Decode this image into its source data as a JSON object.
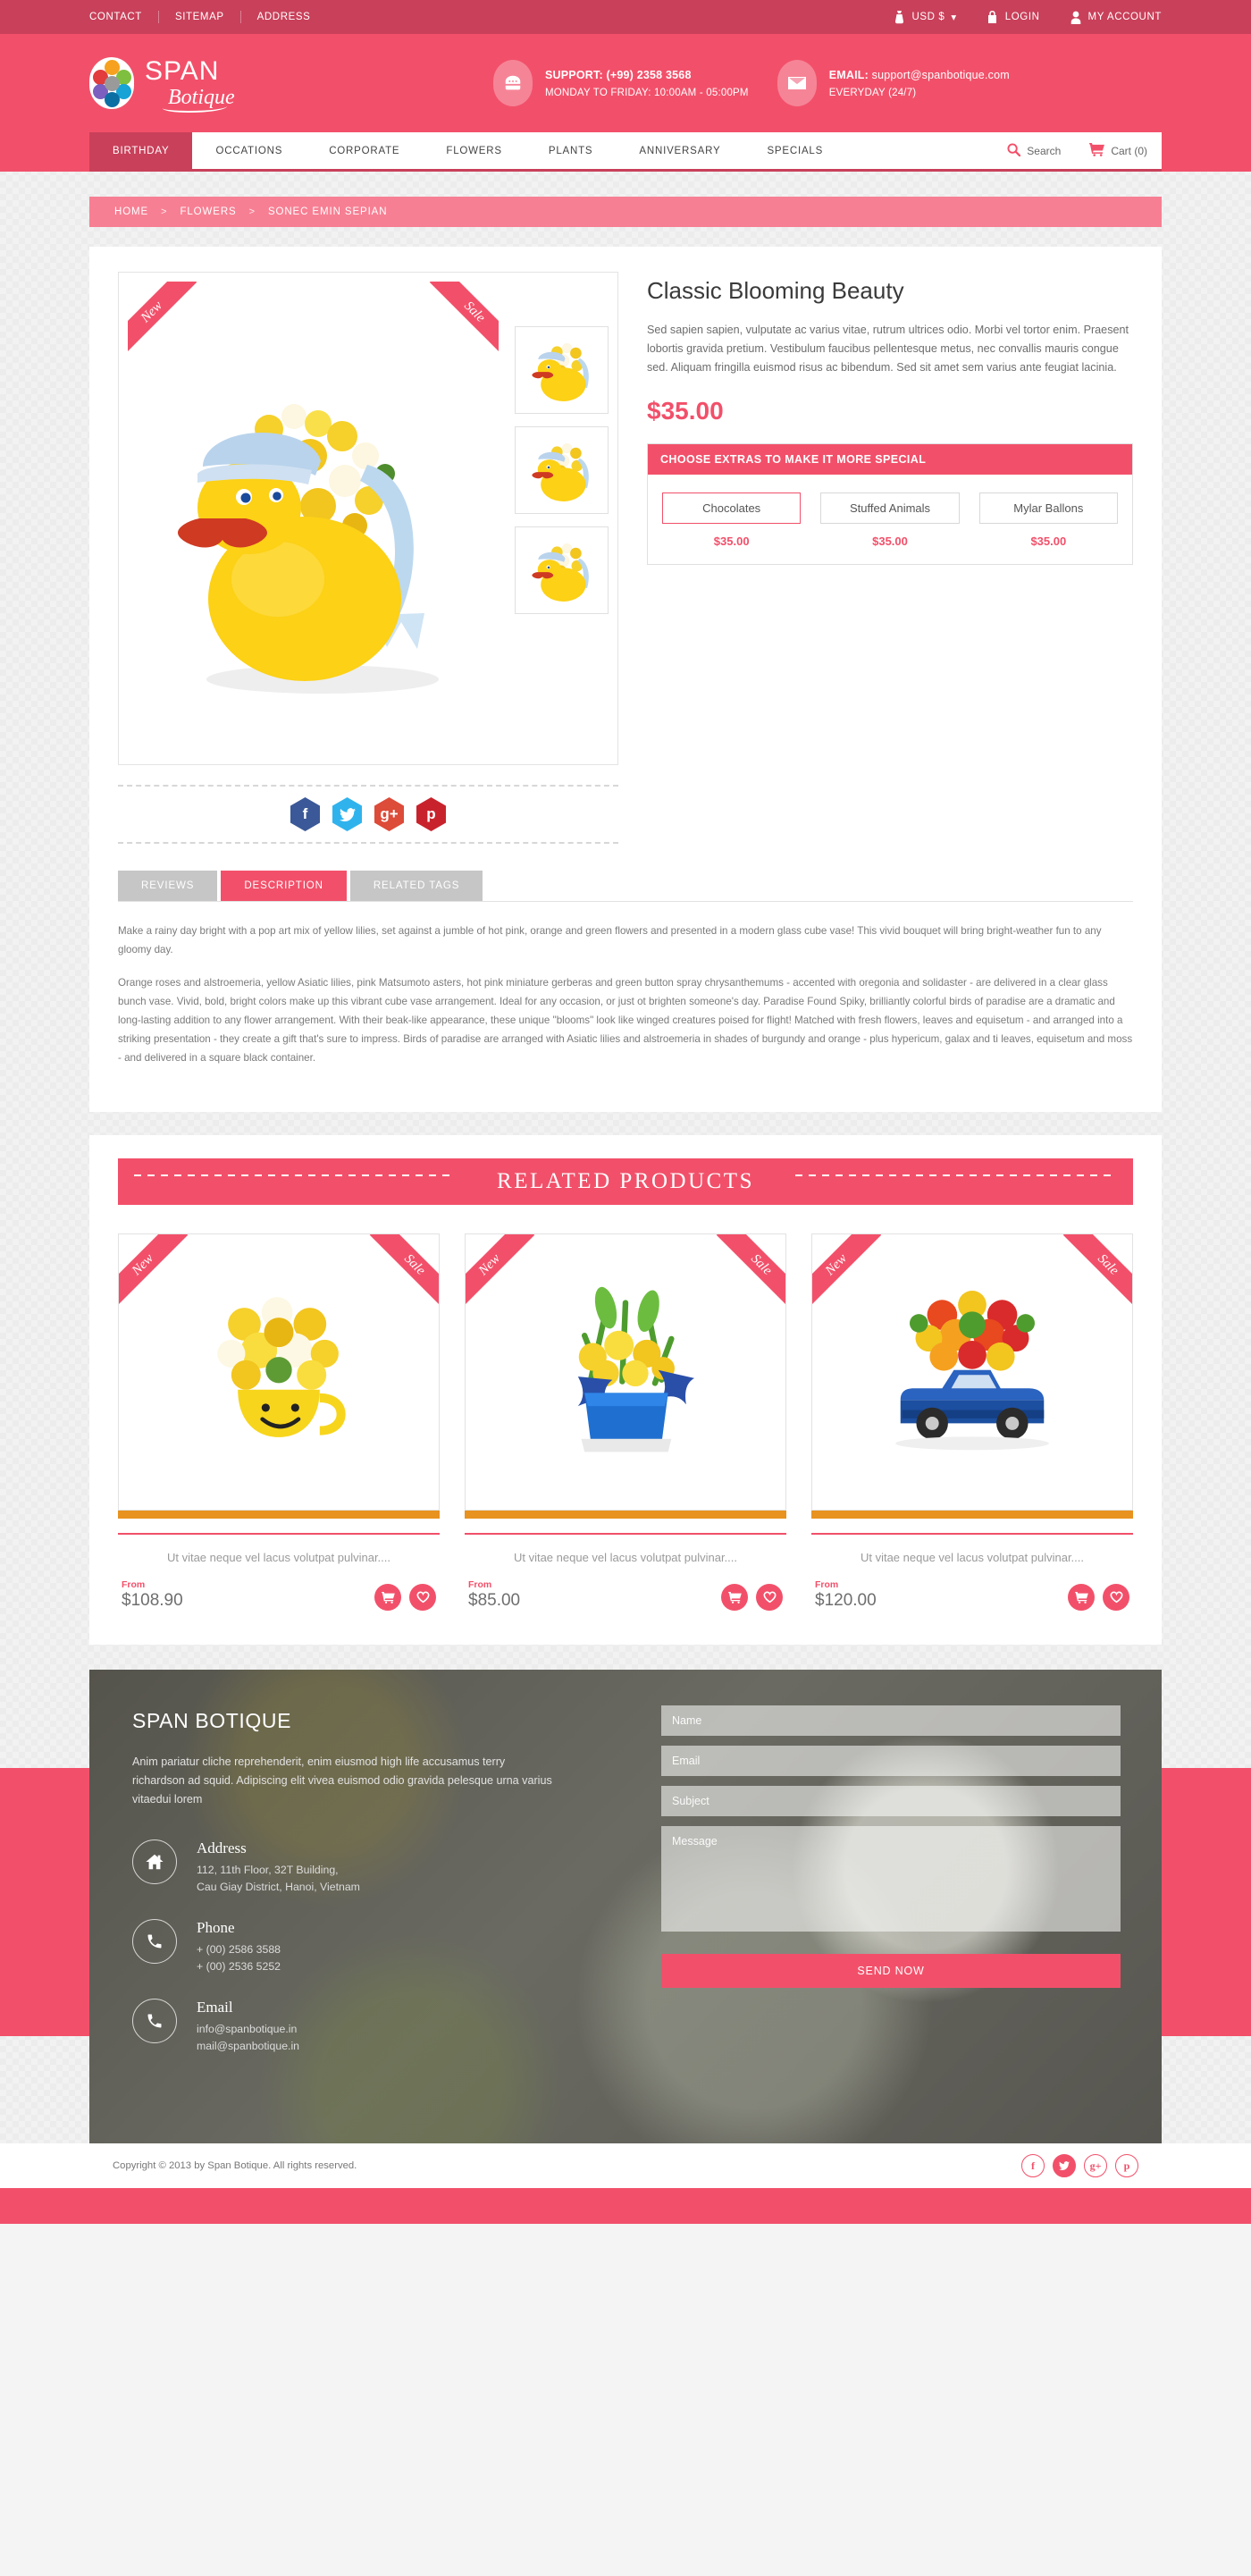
{
  "colors": {
    "brand": "#f2506a",
    "brand_dark": "#c9405a",
    "crumb": "#f77f93",
    "tab_inactive": "#c6c6c6",
    "orange_bar": "#e8921f"
  },
  "topbar": {
    "links": [
      {
        "label": "CONTACT"
      },
      {
        "label": "SITEMAP"
      },
      {
        "label": "ADDRESS"
      }
    ],
    "currency": "USD $",
    "currency_caret": "▾",
    "login": "LOGIN",
    "account": "MY ACCOUNT"
  },
  "header": {
    "logo_top": "SPAN",
    "logo_bottom": "Botique",
    "support": {
      "label": "SUPPORT:",
      "value": "(+99) 2358 3568",
      "hours": "MONDAY TO FRIDAY: 10:00AM - 05:00PM"
    },
    "email": {
      "label": "EMAIL:",
      "value": "support@spanbotique.com",
      "hours": "EVERYDAY (24/7)"
    }
  },
  "nav": {
    "items": [
      {
        "label": "BIRTHDAY",
        "active": true
      },
      {
        "label": "OCCATIONS",
        "active": false
      },
      {
        "label": "CORPORATE",
        "active": false
      },
      {
        "label": "FLOWERS",
        "active": false
      },
      {
        "label": "PLANTS",
        "active": false
      },
      {
        "label": "ANNIVERSARY",
        "active": false
      },
      {
        "label": "SPECIALS",
        "active": false
      }
    ],
    "search_label": "Search",
    "cart_label": "Cart (0)"
  },
  "breadcrumb": {
    "home": "HOME",
    "sep1": ">",
    "category": "FLOWERS",
    "sep2": ">",
    "current": "SONEC EMIN SEPIAN"
  },
  "product": {
    "badge_new": "New",
    "badge_sale": "Sale",
    "title": "Classic Blooming Beauty",
    "description": "Sed sapien sapien, vulputate ac varius vitae, rutrum ultrices odio. Morbi vel tortor enim. Praesent lobortis gravida pretium. Vestibulum faucibus pellentesque metus, nec convallis mauris congue sed. Aliquam fringilla euismod risus ac bibendum. Sed sit amet sem varius ante feugiat lacinia.",
    "price": "$35.00",
    "extras_title": "CHOOSE EXTRAS TO MAKE IT MORE SPECIAL",
    "extras": [
      {
        "label": "Chocolates",
        "price": "$35.00",
        "selected": true
      },
      {
        "label": "Stuffed Animals",
        "price": "$35.00",
        "selected": false
      },
      {
        "label": "Mylar Ballons",
        "price": "$35.00",
        "selected": false
      }
    ],
    "share": [
      {
        "name": "facebook",
        "glyph": "f",
        "color": "#3b5998"
      },
      {
        "name": "twitter",
        "glyph": "t",
        "color": "#30b3ed"
      },
      {
        "name": "googleplus",
        "glyph": "g+",
        "color": "#dd4b39"
      },
      {
        "name": "pinterest",
        "glyph": "p",
        "color": "#c8232c"
      }
    ]
  },
  "tabs": {
    "items": [
      {
        "label": "REVIEWS",
        "active": false
      },
      {
        "label": "DESCRIPTION",
        "active": true
      },
      {
        "label": "RELATED TAGS",
        "active": false
      }
    ],
    "paragraph_1": "Make a rainy day bright with a pop art mix of yellow lilies, set against a jumble of hot pink, orange and green flowers and presented in a modern glass cube vase! This vivid bouquet will bring bright-weather fun to any gloomy day.",
    "paragraph_2": "Orange roses and alstroemeria, yellow Asiatic lilies, pink Matsumoto asters, hot pink miniature gerberas and green button spray chrysanthemums - accented with oregonia and solidaster - are delivered in a clear glass bunch vase. Vivid, bold, bright colors make up this vibrant cube vase arrangement.  Ideal for any occasion, or just ot brighten someone's day. Paradise Found Spiky, brilliantly colorful birds of paradise are a dramatic and long-lasting addition to any flower arrangement. With their beak-like appearance, these unique \"blooms\" look like winged creatures poised for flight! Matched with fresh flowers, leaves and equisetum - and arranged into a striking presentation - they create a gift that's sure to impress. Birds of paradise are arranged with Asiatic lilies and alstroemeria in shades of burgundy and orange - plus hypericum, galax and ti leaves, equisetum and moss - and delivered in a square black container."
  },
  "related": {
    "heading": "RELATED PRODUCTS",
    "products": [
      {
        "badge_new": "New",
        "badge_sale": "Sale",
        "title": "Ut vitae neque vel lacus volutpat pulvinar....",
        "from": "From",
        "price": "$108.90",
        "theme": "smiley"
      },
      {
        "badge_new": "New",
        "badge_sale": "Sale",
        "title": "Ut vitae neque vel lacus volutpat pulvinar....",
        "from": "From",
        "price": "$85.00",
        "theme": "blue-box"
      },
      {
        "badge_new": "New",
        "badge_sale": "Sale",
        "title": "Ut vitae neque vel lacus volutpat pulvinar....",
        "from": "From",
        "price": "$120.00",
        "theme": "truck"
      }
    ]
  },
  "footer": {
    "brand": "SPAN BOTIQUE",
    "about": "Anim pariatur cliche reprehenderit, enim eiusmod high life accusamus terry richardson ad squid. Adipiscing elit vivea euismod odio gravida pelesque urna varius vitaedui lorem",
    "contacts": [
      {
        "icon": "home-icon",
        "title": "Address",
        "line1": "112, 11th Floor, 32T Building,",
        "line2": "Cau Giay District, Hanoi, Vietnam"
      },
      {
        "icon": "phone-icon",
        "title": "Phone",
        "line1": "+ (00) 2586 3588",
        "line2": "+ (00) 2536 5252"
      },
      {
        "icon": "phone-icon",
        "title": "Email",
        "line1": "info@spanbotique.in",
        "line2": "mail@spanbotique.in"
      }
    ],
    "form": {
      "name_placeholder": "Name",
      "email_placeholder": "Email",
      "subject_placeholder": "Subject",
      "message_placeholder": "Message",
      "submit": "SEND NOW"
    },
    "copyright": "Copyright © 2013 by Span Botique.  All rights reserved.",
    "socials": [
      {
        "name": "facebook",
        "glyph": "f",
        "filled": false
      },
      {
        "name": "twitter",
        "glyph": "t",
        "filled": true
      },
      {
        "name": "googleplus",
        "glyph": "g+",
        "filled": false
      },
      {
        "name": "pinterest",
        "glyph": "p",
        "filled": false
      }
    ]
  }
}
